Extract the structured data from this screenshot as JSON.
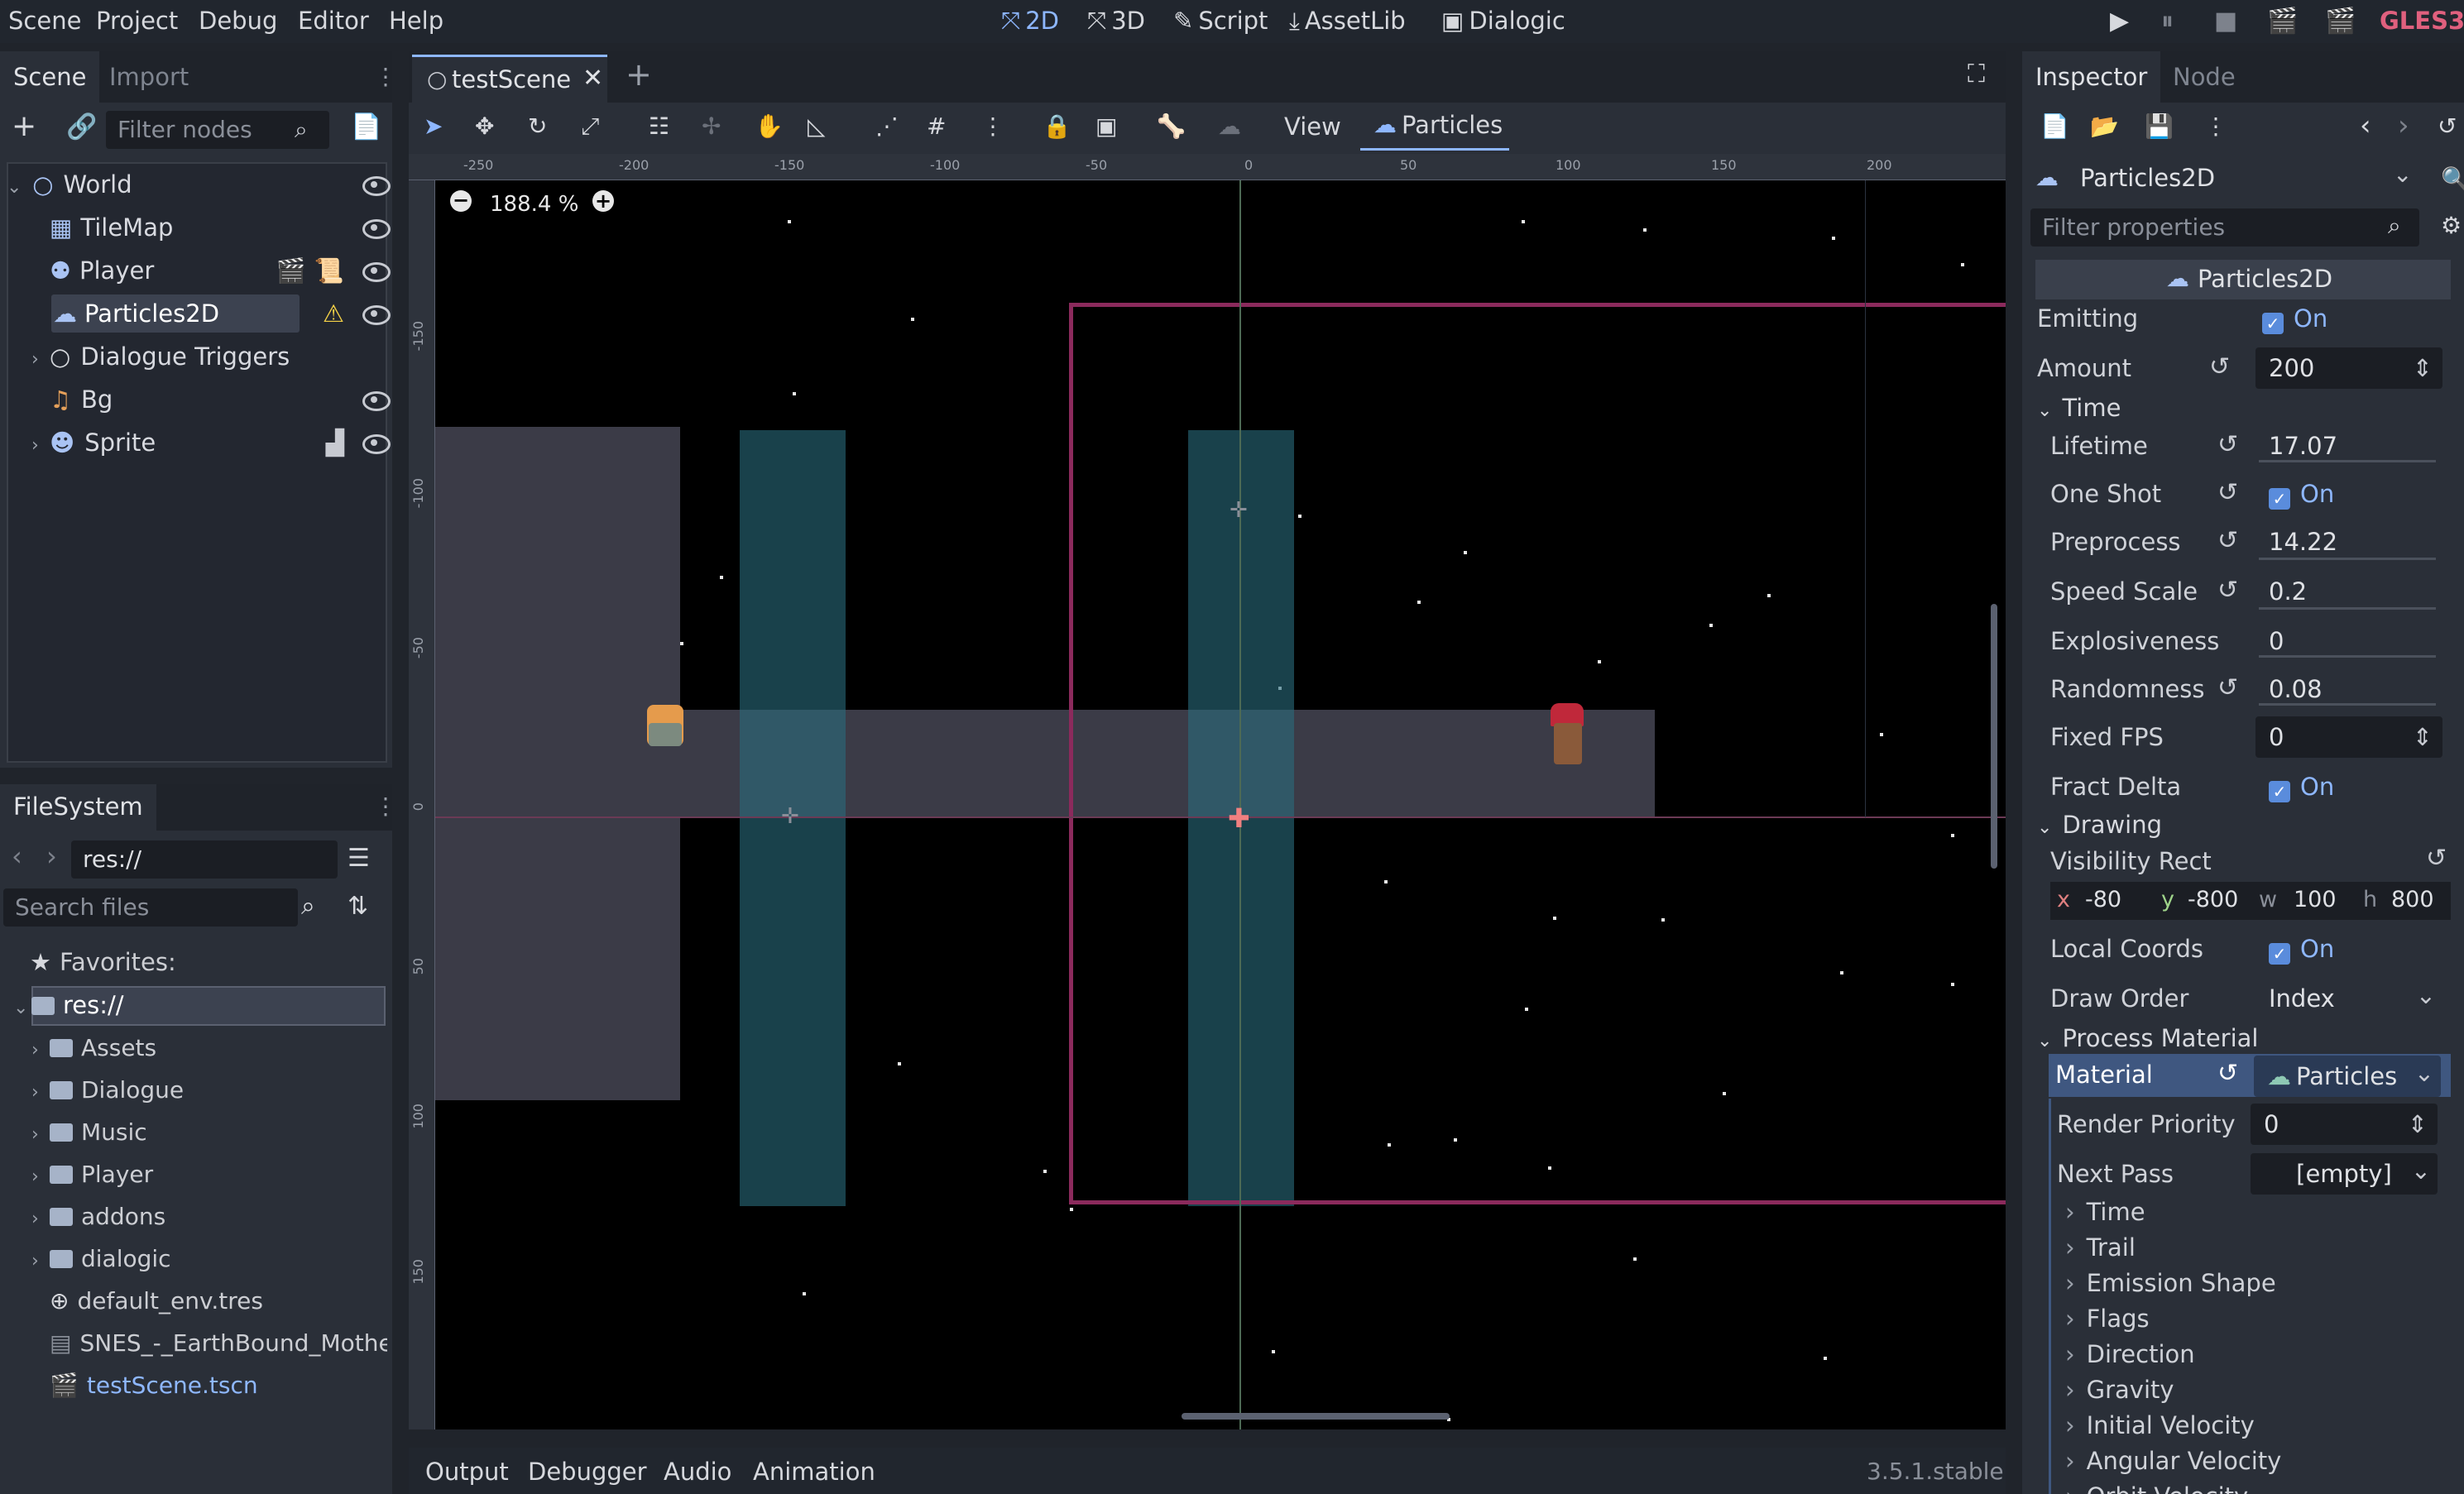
{
  "menu": [
    "Scene",
    "Project",
    "Debug",
    "Editor",
    "Help"
  ],
  "workspaces": [
    {
      "icon": "2d-icon",
      "label": "2D",
      "active": true
    },
    {
      "icon": "3d-icon",
      "label": "3D",
      "active": false
    },
    {
      "icon": "script-icon",
      "label": "Script",
      "active": false
    },
    {
      "icon": "assetlib-icon",
      "label": "AssetLib",
      "active": false
    },
    {
      "icon": "dialogic-icon",
      "label": "Dialogic",
      "active": false
    }
  ],
  "renderer": "GLES3",
  "scene_dock": {
    "tabs": [
      "Scene",
      "Import"
    ],
    "filter_placeholder": "Filter nodes",
    "tree": [
      {
        "label": "World",
        "icon": "node2d-icon",
        "indent": 0,
        "expanded": true
      },
      {
        "label": "TileMap",
        "icon": "tilemap-icon",
        "indent": 1
      },
      {
        "label": "Player",
        "icon": "kinematic-body-icon",
        "indent": 1
      },
      {
        "label": "Particles2D",
        "icon": "particles-icon",
        "indent": 1,
        "selected": true
      },
      {
        "label": "Dialogue Triggers",
        "icon": "node2d-icon",
        "indent": 1,
        "collapsed": true
      },
      {
        "label": "Bg",
        "icon": "audio-stream-icon",
        "indent": 1
      },
      {
        "label": "Sprite",
        "icon": "sprite-icon",
        "indent": 1,
        "collapsed": true
      }
    ]
  },
  "filesystem": {
    "title": "FileSystem",
    "path": "res://",
    "search_placeholder": "Search files",
    "favorites_label": "Favorites:",
    "root": "res://",
    "items": [
      {
        "label": "Assets",
        "type": "folder"
      },
      {
        "label": "Dialogue",
        "type": "folder"
      },
      {
        "label": "Music",
        "type": "folder"
      },
      {
        "label": "Player",
        "type": "folder"
      },
      {
        "label": "addons",
        "type": "folder"
      },
      {
        "label": "dialogic",
        "type": "folder"
      },
      {
        "label": "default_env.tres",
        "type": "resource"
      },
      {
        "label": "SNES_-_EarthBound_Mothe",
        "type": "image"
      },
      {
        "label": "testScene.tscn",
        "type": "scene",
        "highlight": true
      }
    ]
  },
  "editor": {
    "scene_tab": "testScene",
    "view_label": "View",
    "particles_label": "Particles",
    "zoom": "188.4 %",
    "ruler_x": [
      "-250",
      "-200",
      "-150",
      "-100",
      "-50",
      "0",
      "50",
      "100",
      "150",
      "200"
    ],
    "ruler_y": [
      "-150",
      "-100",
      "-50",
      "0",
      "50",
      "100",
      "150"
    ]
  },
  "inspector": {
    "tabs": [
      "Inspector",
      "Node"
    ],
    "object": "Particles2D",
    "filter_placeholder": "Filter properties",
    "class_header": "Particles2D",
    "on_label": "On",
    "emitting_label": "Emitting",
    "amount_label": "Amount",
    "amount": "200",
    "time_section": "Time",
    "lifetime_label": "Lifetime",
    "lifetime": "17.07",
    "one_shot_label": "One Shot",
    "preprocess_label": "Preprocess",
    "preprocess": "14.22",
    "speed_scale_label": "Speed Scale",
    "speed_scale": "0.2",
    "explosiveness_label": "Explosiveness",
    "explosiveness": "0",
    "randomness_label": "Randomness",
    "randomness": "0.08",
    "fixed_fps_label": "Fixed FPS",
    "fixed_fps": "0",
    "fract_delta_label": "Fract Delta",
    "drawing_section": "Drawing",
    "visibility_rect_label": "Visibility Rect",
    "visibility_rect": {
      "x": "-80",
      "y": "-800",
      "w": "100",
      "h": "800"
    },
    "local_coords_label": "Local Coords",
    "draw_order_label": "Draw Order",
    "draw_order": "Index",
    "process_material_section": "Process Material",
    "material_label": "Material",
    "material_value": "Particles",
    "render_priority_label": "Render Priority",
    "render_priority": "0",
    "next_pass_label": "Next Pass",
    "next_pass": "[empty]",
    "subsections": [
      "Time",
      "Trail",
      "Emission Shape",
      "Flags",
      "Direction",
      "Gravity",
      "Initial Velocity",
      "Angular Velocity",
      "Orbit Velocity"
    ]
  },
  "bottom": {
    "tabs": [
      "Output",
      "Debugger",
      "Audio",
      "Animation"
    ],
    "version": "3.5.1.stable"
  },
  "colors": {
    "accent": "#8eb7ff",
    "renderer": "#e0607e",
    "camera_rect": "#8b2a5c",
    "area": "#1f4f5c",
    "tile": "#3b3b47"
  }
}
